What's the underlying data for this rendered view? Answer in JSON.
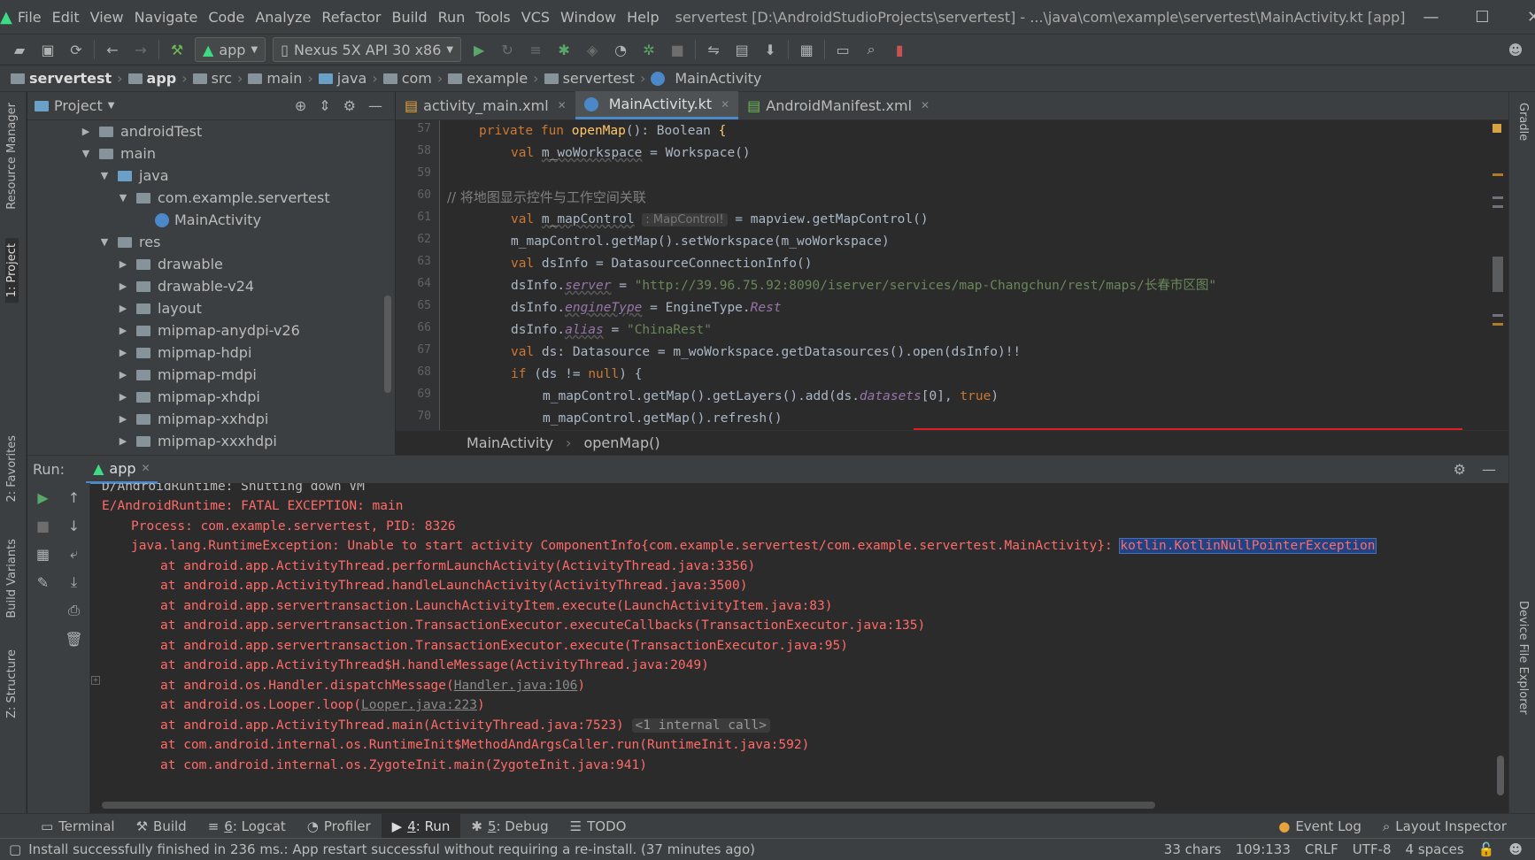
{
  "menu": {
    "items": [
      "File",
      "Edit",
      "View",
      "Navigate",
      "Code",
      "Analyze",
      "Refactor",
      "Build",
      "Run",
      "Tools",
      "VCS",
      "Window",
      "Help"
    ],
    "window_title": "servertest [D:\\AndroidStudioProjects\\servertest] - ...\\java\\com\\example\\servertest\\MainActivity.kt [app]"
  },
  "toolbar": {
    "run_config": "app",
    "device": "Nexus 5X API 30 x86"
  },
  "breadcrumb": [
    "servertest",
    "app",
    "src",
    "main",
    "java",
    "com",
    "example",
    "servertest",
    "MainActivity"
  ],
  "left_strip": [
    "Resource Manager",
    "1: Project",
    "2: Favorites",
    "Build Variants",
    "Z: Structure"
  ],
  "right_strip": [
    "Gradle",
    "Device File Explorer"
  ],
  "project": {
    "header": "Project",
    "tree": [
      {
        "label": "androidTest",
        "indent": 1,
        "arrow": "▶",
        "icon": "folder"
      },
      {
        "label": "main",
        "indent": 1,
        "arrow": "▼",
        "icon": "folder"
      },
      {
        "label": "java",
        "indent": 2,
        "arrow": "▼",
        "icon": "folder-blue"
      },
      {
        "label": "com.example.servertest",
        "indent": 3,
        "arrow": "▼",
        "icon": "folder"
      },
      {
        "label": "MainActivity",
        "indent": 4,
        "arrow": "",
        "icon": "kotlin"
      },
      {
        "label": "res",
        "indent": 2,
        "arrow": "▼",
        "icon": "folder"
      },
      {
        "label": "drawable",
        "indent": 3,
        "arrow": "▶",
        "icon": "folder"
      },
      {
        "label": "drawable-v24",
        "indent": 3,
        "arrow": "▶",
        "icon": "folder"
      },
      {
        "label": "layout",
        "indent": 3,
        "arrow": "▶",
        "icon": "folder"
      },
      {
        "label": "mipmap-anydpi-v26",
        "indent": 3,
        "arrow": "▶",
        "icon": "folder"
      },
      {
        "label": "mipmap-hdpi",
        "indent": 3,
        "arrow": "▶",
        "icon": "folder"
      },
      {
        "label": "mipmap-mdpi",
        "indent": 3,
        "arrow": "▶",
        "icon": "folder"
      },
      {
        "label": "mipmap-xhdpi",
        "indent": 3,
        "arrow": "▶",
        "icon": "folder"
      },
      {
        "label": "mipmap-xxhdpi",
        "indent": 3,
        "arrow": "▶",
        "icon": "folder"
      },
      {
        "label": "mipmap-xxxhdpi",
        "indent": 3,
        "arrow": "▶",
        "icon": "folder"
      }
    ]
  },
  "editor": {
    "tabs": [
      {
        "label": "activity_main.xml",
        "active": false
      },
      {
        "label": "MainActivity.kt",
        "active": true
      },
      {
        "label": "AndroidManifest.xml",
        "active": false
      }
    ],
    "line_numbers": [
      "57",
      "58",
      "59",
      "60",
      "61",
      "62",
      "63",
      "64",
      "65",
      "66",
      "67",
      "68",
      "69",
      "70"
    ],
    "code": {
      "l57_kw": "private fun ",
      "l57_fn": "openMap",
      "l57_rest": "(): Boolean ",
      "l57_brace": "{",
      "l58_kw": "val ",
      "l58_var": "m_woWorkspace",
      "l58_rest": " = Workspace()",
      "l60_comment": "// 将地图显示控件与工作空间关联",
      "l61_kw": "val ",
      "l61_var": "m_mapControl",
      "l61_hint": ": MapControl!",
      "l61_rest": " = mapview.getMapControl()",
      "l62_text": "m_mapControl.getMap().setWorkspace(m_woWorkspace)",
      "l63_kw": "val ",
      "l63_rest": "dsInfo = DatasourceConnectionInfo()",
      "l64_a": "dsInfo.",
      "l64_prop": "server",
      "l64_b": " = ",
      "l64_str": "\"http://39.96.75.92:8090/iserver/services/map-Changchun/rest/maps/长春市区图\"",
      "l65_a": "dsInfo.",
      "l65_prop": "engineType",
      "l65_b": " = EngineType.",
      "l65_c": "Rest",
      "l66_a": "dsInfo.",
      "l66_prop": "alias",
      "l66_b": " = ",
      "l66_str": "\"ChinaRest\"",
      "l67_kw": "val ",
      "l67_rest": "ds: Datasource = m_woWorkspace.getDatasources().open(dsInfo)!!",
      "l68_kw": "if ",
      "l68_a": "(ds != ",
      "l68_null": "null",
      "l68_b": ") {",
      "l69_a": "m_mapControl.getMap().getLayers().add(ds.",
      "l69_prop": "datasets",
      "l69_b": "[0], ",
      "l69_true": "true",
      "l69_c": ")",
      "l70_text": "m_mapControl.getMap().refresh()"
    },
    "bottom_crumb": [
      "MainActivity",
      "openMap()"
    ]
  },
  "run": {
    "label": "Run:",
    "tab": "app",
    "lines": [
      {
        "text": "D/AndroidRuntime: Shutting down VM",
        "indent": 0,
        "color": "gray"
      },
      {
        "text": "E/AndroidRuntime: FATAL EXCEPTION: main",
        "indent": 0,
        "color": "red"
      },
      {
        "text": "Process: com.example.servertest, PID: 8326",
        "indent": 1,
        "color": "red"
      }
    ],
    "exception_prefix": "java.lang.RuntimeException: Unable to start activity ComponentInfo{com.example.servertest/com.example.servertest.MainActivity}: ",
    "exception_selected": "kotlin.KotlinNullPointerException",
    "stack": [
      "at android.app.ActivityThread.performLaunchActivity(ActivityThread.java:3356)",
      "at android.app.ActivityThread.handleLaunchActivity(ActivityThread.java:3500)",
      "at android.app.servertransaction.LaunchActivityItem.execute(LaunchActivityItem.java:83)",
      "at android.app.servertransaction.TransactionExecutor.executeCallbacks(TransactionExecutor.java:135)",
      "at android.app.servertransaction.TransactionExecutor.execute(TransactionExecutor.java:95)",
      "at android.app.ActivityThread$H.handleMessage(ActivityThread.java:2049)"
    ],
    "handler_prefix": "at android.os.Handler.dispatchMessage(",
    "handler_link": "Handler.java:106",
    "looper_prefix": "at android.os.Looper.loop(",
    "looper_link": "Looper.java:223",
    "close_paren": ")",
    "main_line": "at android.app.ActivityThread.main(ActivityThread.java:7523)",
    "internal_call": "<1 internal call>",
    "runtime_line": "at com.android.internal.os.RuntimeInit$MethodAndArgsCaller.run(RuntimeInit.java:592)",
    "zygote_line": "at com.android.internal.os.ZygoteInit.main(ZygoteInit.java:941)"
  },
  "bottom_tabs": {
    "terminal": "Terminal",
    "build": "Build",
    "logcat_num": "6",
    "logcat": ": Logcat",
    "profiler": "Profiler",
    "run_num": "4",
    "run": ": Run",
    "debug_num": "5",
    "debug": ": Debug",
    "todo": "TODO",
    "event_log": "Event Log",
    "layout_inspector": "Layout Inspector"
  },
  "status": {
    "message": "Install successfully finished in 236 ms.: App restart successful without requiring a re-install. (37 minutes ago)",
    "chars": "33 chars",
    "position": "109:133",
    "line_sep": "CRLF",
    "encoding": "UTF-8",
    "indent": "4 spaces"
  },
  "colors": {
    "accent": "#4a88c7",
    "error_red": "#ff6b68",
    "highlight_box": "#e02020",
    "android_green": "#3ddc84"
  }
}
